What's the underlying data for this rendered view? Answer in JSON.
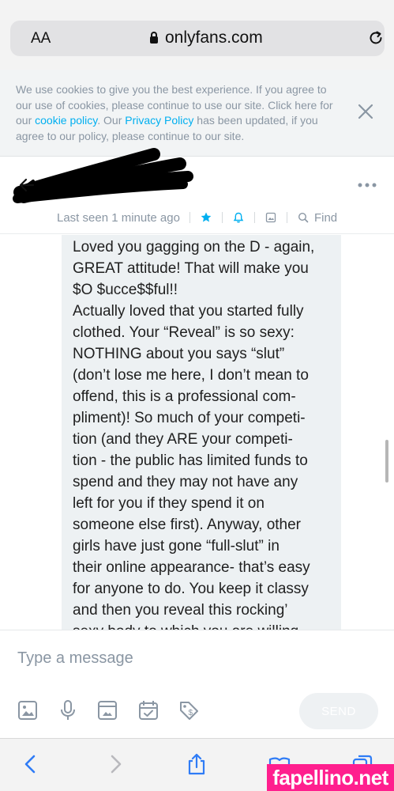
{
  "browser": {
    "text_size_label": "AA",
    "domain": "onlyfans.com",
    "icons": {
      "lock": "lock-icon",
      "reload": "reload-icon"
    }
  },
  "cookie_banner": {
    "text_1": "We use cookies to give you the best experience. If you agree to our use of cookies, please continue to use our site. Click here for our ",
    "cookie_link": "cookie policy",
    "text_2": ". Our ",
    "privacy_link": "Privacy Policy",
    "text_3": " has been updated, if you agree to our policy, please continue to our site.",
    "close_icon": "close-icon"
  },
  "chat_header": {
    "last_seen": "Last seen 1 minute ago",
    "find_label": "Find",
    "icons": [
      "back-arrow-icon",
      "more-dots-icon",
      "star-icon",
      "bell-icon",
      "media-icon",
      "search-icon"
    ]
  },
  "message": {
    "text": "Loved you gagging on the D - again,\nGREAT attitude! That will make you\n$O $ucce$$ful!!\nActually loved that you started fully\nclothed. Your “Reveal” is so sexy:\nNOTHING about you says “slut”\n(don’t lose me here, I don’t mean to\noffend, this is a professional com-\npliment)! So much of your competi-\ntion (and they ARE your competi-\ntion - the public has limited funds to\nspend and they may not have any\nleft for you if they spend it on\nsomeone else first). Anyway, other\ngirls have just gone “full-slut” in\ntheir online appearance- that’s easy\nfor anyone to do. You keep it classy\nand then you reveal this rocking’\nsexy body to which you are willing"
  },
  "composer": {
    "placeholder": "Type a message",
    "send_label": "SEND",
    "tools": [
      "image-icon",
      "microphone-icon",
      "vault-icon",
      "schedule-icon",
      "price-tag-icon"
    ]
  },
  "safari_toolbar": {
    "icons": [
      "back-icon",
      "forward-icon",
      "share-icon",
      "bookmarks-icon",
      "tabs-icon"
    ]
  },
  "watermark": "fapellino.net",
  "colors": {
    "accent": "#00aff0",
    "muted_text": "#8a96a3",
    "bubble": "#edf1f3",
    "watermark_bg": "#ff1f8e"
  }
}
